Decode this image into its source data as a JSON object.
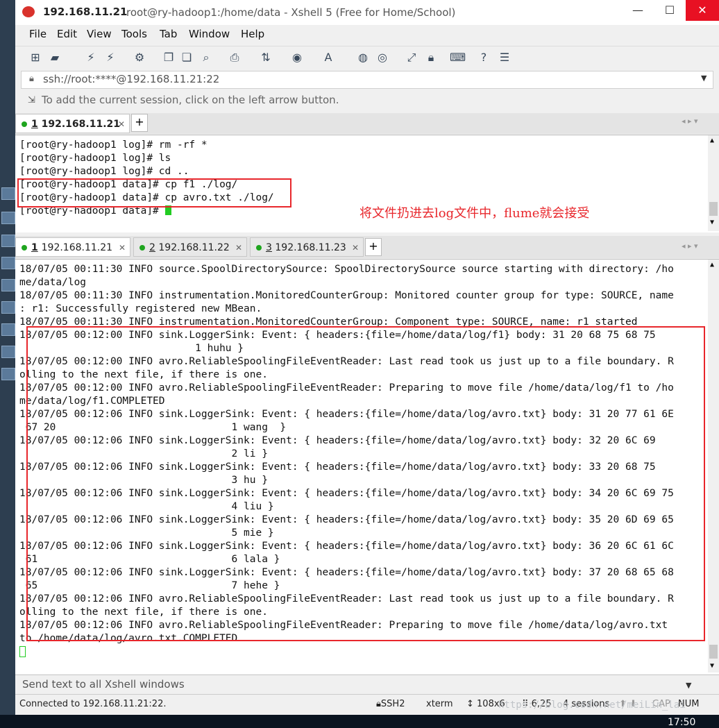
{
  "window": {
    "title_ip": "192.168.11.21",
    "title_rest": "root@ry-hadoop1:/home/data - Xshell 5 (Free for Home/School)",
    "minimize": "—",
    "maximize": "☐",
    "close": "✕"
  },
  "menu": [
    "File",
    "Edit",
    "View",
    "Tools",
    "Tab",
    "Window",
    "Help"
  ],
  "address": {
    "value": "ssh://root:****@192.168.11.21:22"
  },
  "hint": "To add the current session, click on the left arrow button.",
  "top_tab": {
    "number": "1",
    "label": "192.168.11.21"
  },
  "top_terminal": [
    "[root@ry-hadoop1 log]# rm -rf *",
    "[root@ry-hadoop1 log]# ls",
    "[root@ry-hadoop1 log]# cd ..",
    "[root@ry-hadoop1 data]# cp f1 ./log/",
    "[root@ry-hadoop1 data]# cp avro.txt ./log/",
    "[root@ry-hadoop1 data]# "
  ],
  "annotation": "将文件扔进去log文件中，flume就会接受",
  "bottom_tabs": [
    {
      "number": "1",
      "label": "192.168.11.21"
    },
    {
      "number": "2",
      "label": "192.168.11.22"
    },
    {
      "number": "3",
      "label": "192.168.11.23"
    }
  ],
  "bottom_terminal": [
    "18/07/05 00:11:30 INFO source.SpoolDirectorySource: SpoolDirectorySource source starting with directory: /ho",
    "me/data/log",
    "18/07/05 00:11:30 INFO instrumentation.MonitoredCounterGroup: Monitored counter group for type: SOURCE, name",
    ": r1: Successfully registered new MBean.",
    "18/07/05 00:11:30 INFO instrumentation.MonitoredCounterGroup: Component type: SOURCE, name: r1 started",
    "18/07/05 00:12:00 INFO sink.LoggerSink: Event: { headers:{file=/home/data/log/f1} body: 31 20 68 75 68 75",
    "                             1 huhu }",
    "18/07/05 00:12:00 INFO avro.ReliableSpoolingFileEventReader: Last read took us just up to a file boundary. R",
    "olling to the next file, if there is one.",
    "18/07/05 00:12:00 INFO avro.ReliableSpoolingFileEventReader: Preparing to move file /home/data/log/f1 to /ho",
    "me/data/log/f1.COMPLETED",
    "18/07/05 00:12:06 INFO sink.LoggerSink: Event: { headers:{file=/home/data/log/avro.txt} body: 31 20 77 61 6E",
    " 67 20                             1 wang  }",
    "18/07/05 00:12:06 INFO sink.LoggerSink: Event: { headers:{file=/home/data/log/avro.txt} body: 32 20 6C 69",
    "                                   2 li }",
    "18/07/05 00:12:06 INFO sink.LoggerSink: Event: { headers:{file=/home/data/log/avro.txt} body: 33 20 68 75",
    "                                   3 hu }",
    "18/07/05 00:12:06 INFO sink.LoggerSink: Event: { headers:{file=/home/data/log/avro.txt} body: 34 20 6C 69 75",
    "                                   4 liu }",
    "18/07/05 00:12:06 INFO sink.LoggerSink: Event: { headers:{file=/home/data/log/avro.txt} body: 35 20 6D 69 65",
    "                                   5 mie }",
    "18/07/05 00:12:06 INFO sink.LoggerSink: Event: { headers:{file=/home/data/log/avro.txt} body: 36 20 6C 61 6C",
    " 61                                6 lala }",
    "18/07/05 00:12:06 INFO sink.LoggerSink: Event: { headers:{file=/home/data/log/avro.txt} body: 37 20 68 65 68",
    " 65                                7 hehe }",
    "18/07/05 00:12:06 INFO avro.ReliableSpoolingFileEventReader: Last read took us just up to a file boundary. R",
    "olling to the next file, if there is one.",
    "18/07/05 00:12:06 INFO avro.ReliableSpoolingFileEventReader: Preparing to move file /home/data/log/avro.txt",
    "to /home/data/log/avro.txt.COMPLETED"
  ],
  "send_bar": "Send text to all Xshell windows",
  "status": {
    "connection": "Connected to 192.168.11.21:22.",
    "protocol": "SSH2",
    "term": "xterm",
    "size": "108x6",
    "cursor_pos": "6,25",
    "sessions": "4 sessions",
    "caps": "CAP",
    "num": "NUM"
  },
  "watermark": "https://blog.csdn.net/meiLin_lai",
  "clock": "17:50",
  "colors": {
    "accent_red": "#e8262b",
    "cursor_green": "#22cc22",
    "session_dot": "#1fa51f"
  }
}
